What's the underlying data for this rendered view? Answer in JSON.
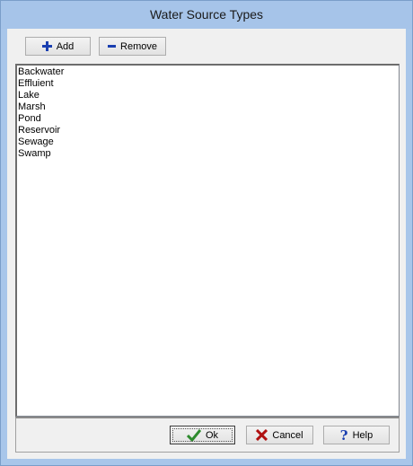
{
  "window": {
    "title": "Water Source Types"
  },
  "toolbar": {
    "add_label": "Add",
    "remove_label": "Remove"
  },
  "list": {
    "items": [
      "Backwater",
      "Effluient",
      "Lake",
      "Marsh",
      "Pond",
      "Reservoir",
      "Sewage",
      "Swamp"
    ]
  },
  "footer": {
    "ok_label": "Ok",
    "cancel_label": "Cancel",
    "help_label": "Help"
  },
  "colors": {
    "plus": "#1a3fb0",
    "minus": "#1a3fb0",
    "check": "#2e8b2e",
    "cross": "#b01010",
    "help": "#1a3fb0"
  },
  "icons": {
    "add": "plus-icon",
    "remove": "minus-icon",
    "ok": "checkmark-icon",
    "cancel": "x-icon",
    "help": "question-icon"
  }
}
